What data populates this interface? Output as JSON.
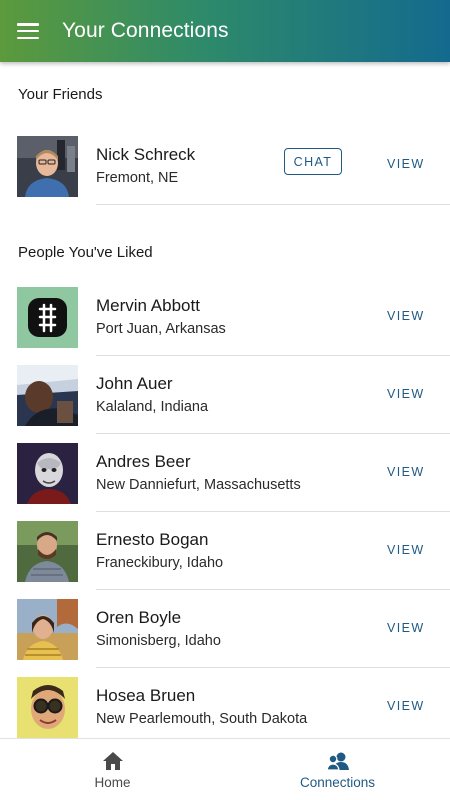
{
  "app_bar": {
    "title": "Your Connections",
    "menu_icon": "hamburger-menu-icon",
    "gradient": [
      "#5c9a3c",
      "#136a8e"
    ]
  },
  "friends_section": {
    "header": "Your Friends",
    "items": [
      {
        "name": "Nick Schreck",
        "location": "Fremont, NE",
        "chat_label": "CHAT",
        "view_label": "VIEW"
      }
    ]
  },
  "liked_section": {
    "header": "People You've Liked",
    "items": [
      {
        "name": "Mervin Abbott",
        "location": "Port Juan, Arkansas",
        "view_label": "VIEW"
      },
      {
        "name": "John Auer",
        "location": "Kalaland, Indiana",
        "view_label": "VIEW"
      },
      {
        "name": "Andres Beer",
        "location": "New Danniefurt, Massachusetts",
        "view_label": "VIEW"
      },
      {
        "name": "Ernesto Bogan",
        "location": "Franeckibury, Idaho",
        "view_label": "VIEW"
      },
      {
        "name": "Oren Boyle",
        "location": "Simonisberg, Idaho",
        "view_label": "VIEW"
      },
      {
        "name": "Hosea Bruen",
        "location": "New Pearlemouth, South Dakota",
        "view_label": "VIEW"
      }
    ]
  },
  "bottom_nav": {
    "items": [
      {
        "label": "Home",
        "icon": "home-icon",
        "active": false
      },
      {
        "label": "Connections",
        "icon": "connections-icon",
        "active": true
      }
    ]
  },
  "colors": {
    "accent": "#1f5a84",
    "divider": "#dedede"
  }
}
